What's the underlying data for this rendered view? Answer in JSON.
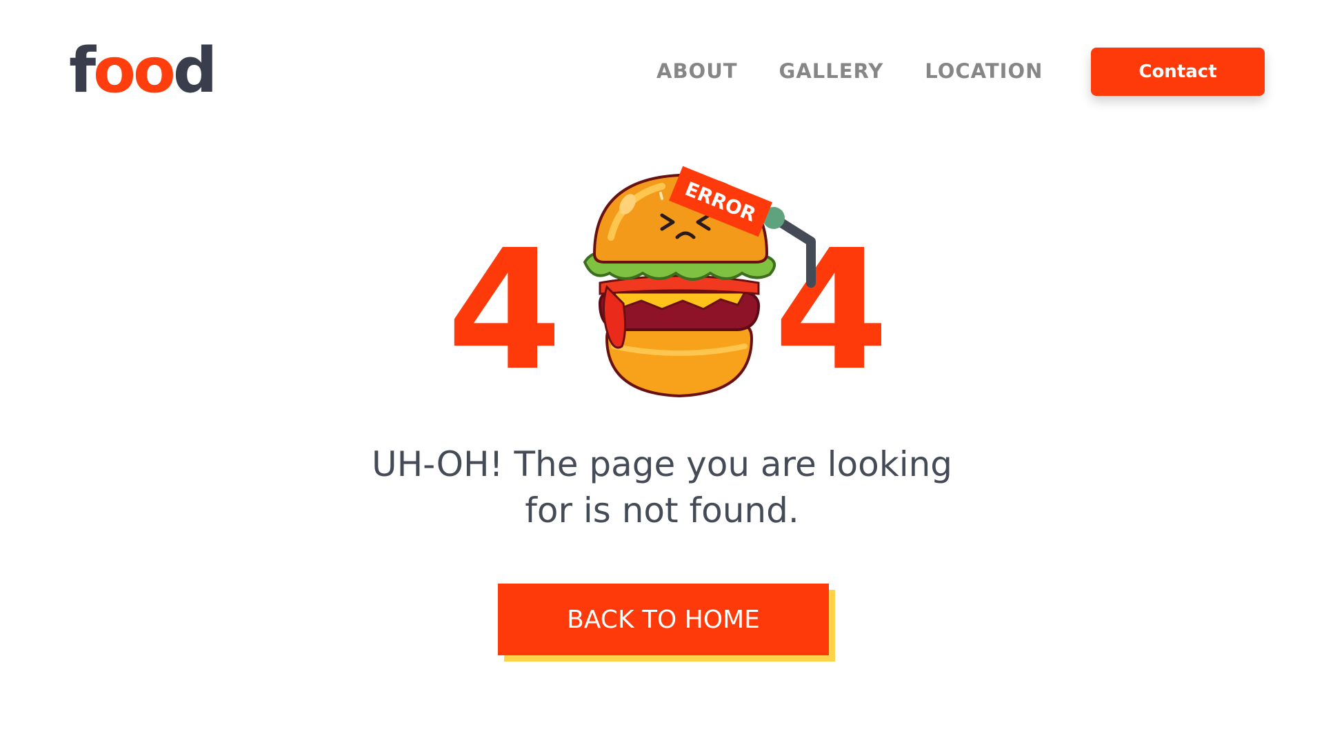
{
  "header": {
    "logo": {
      "part1": "f",
      "part2": "oo",
      "part3": "d"
    },
    "nav": [
      {
        "label": "ABOUT"
      },
      {
        "label": "GALLERY"
      },
      {
        "label": "LOCATION"
      }
    ],
    "contact_label": "Contact"
  },
  "error": {
    "digit_left": "4",
    "digit_right": "4",
    "sign_text": "ERROR",
    "illustration_icon": "angry-burger-icon"
  },
  "message": {
    "line1": "UH-OH! The page you are looking",
    "line2": "for is not found."
  },
  "home_button_label": "BACK TO HOME",
  "colors": {
    "accent": "#ff3a0a",
    "text_dark": "#454a57",
    "nav_gray": "#868686",
    "button_shadow": "#ffd24c"
  }
}
